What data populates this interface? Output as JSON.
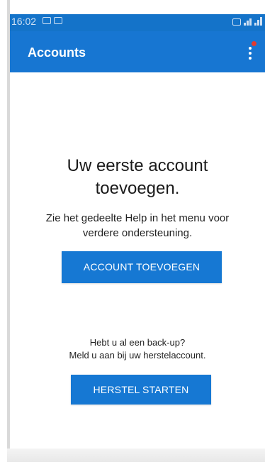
{
  "status_bar": {
    "time": "16:02"
  },
  "app_bar": {
    "title": "Accounts",
    "menu_icon": "more-vert-icon",
    "notification_color": "#e23a2e",
    "background_color": "#1776d2"
  },
  "empty_state": {
    "heading_line1": "Uw eerste account",
    "heading_line2": "toevoegen.",
    "help_line1": "Zie het gedeelte Help in het menu voor",
    "help_line2": "verdere ondersteuning.",
    "add_account_label": "ACCOUNT TOEVOEGEN"
  },
  "restore": {
    "question": "Hebt u al een back-up?",
    "instruction": "Meld u aan bij uw herstelaccount.",
    "button_label": "HERSTEL STARTEN"
  }
}
